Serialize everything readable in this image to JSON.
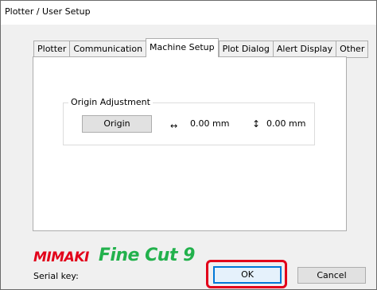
{
  "window": {
    "title": "Plotter / User Setup"
  },
  "tabs": [
    {
      "label": "Plotter",
      "active": false
    },
    {
      "label": "Communication",
      "active": false
    },
    {
      "label": "Machine Setup",
      "active": true
    },
    {
      "label": "Plot Dialog",
      "active": false
    },
    {
      "label": "Alert Display",
      "active": false
    },
    {
      "label": "Other",
      "active": false
    }
  ],
  "origin_adjustment": {
    "group_label": "Origin Adjustment",
    "button_label": "Origin",
    "x_arrow": "↔",
    "x_value": "0.00 mm",
    "y_arrow": "↕",
    "y_value": "0.00 mm"
  },
  "branding": {
    "company_logo": "MIMAKI",
    "product_logo": "FineCut9",
    "brand_colors": {
      "mimaki": "#e2001a",
      "finecut": "#22b14c"
    }
  },
  "footer": {
    "serial_label": "Serial key:",
    "ok_label": "OK",
    "cancel_label": "Cancel"
  },
  "highlight": {
    "target": "ok-button",
    "color": "#e2001a"
  }
}
